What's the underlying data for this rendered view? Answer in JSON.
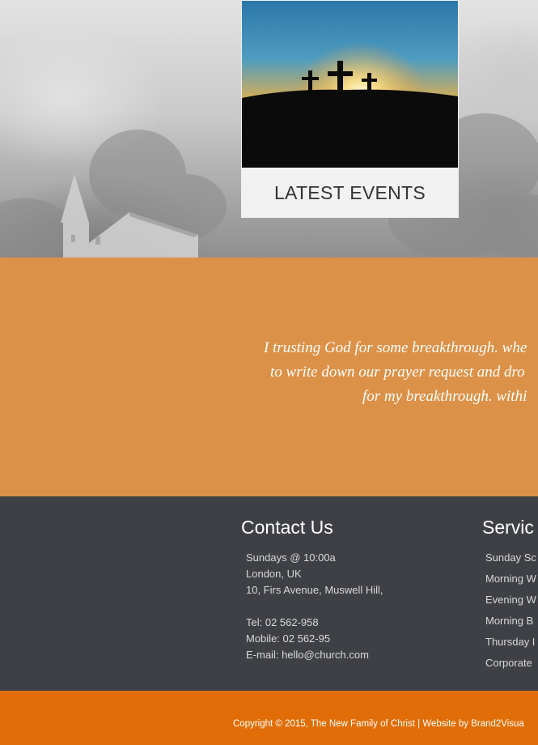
{
  "events": {
    "title": "LATEST EVENTS",
    "image_icon": "three-crosses-sunset-photo"
  },
  "testimonial": {
    "lines": [
      "I trusting God for some breakthrough. whe",
      "to write down our prayer request and dro",
      "for my breakthrough. withi"
    ]
  },
  "contact": {
    "heading": "Contact Us",
    "hours": "Sundays @ 10:00a",
    "city": "London, UK",
    "address": "10, Firs Avenue, Muswell Hill,",
    "tel": "Tel: 02 562-958",
    "mobile": "Mobile: 02 562-95",
    "email_label": "E-mail: ",
    "email": "hello@church.com"
  },
  "services": {
    "heading": "Servic",
    "items": [
      "Sunday Sc",
      "Morning W",
      "Evening W",
      "Morning B",
      "Thursday I",
      "Corporate"
    ]
  },
  "copyright": {
    "text": "Copyright © 2015, The New Family of Christ",
    "separator": " | ",
    "credit_prefix": "Website by ",
    "credit_link": "Brand2Visua"
  },
  "colors": {
    "testimonial_bg": "#dc9148",
    "footer_bg": "#3f4045",
    "copyright_bg": "#e06d08"
  }
}
